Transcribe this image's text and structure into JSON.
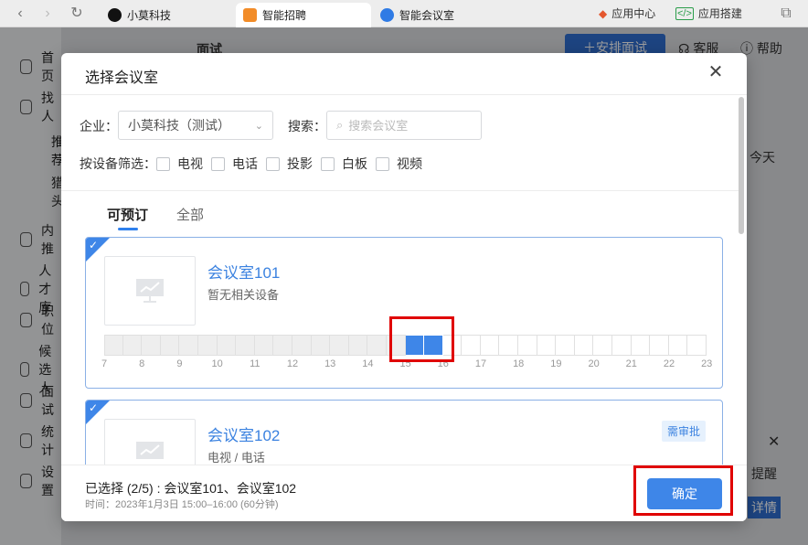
{
  "browser": {
    "tabs": [
      {
        "label": "小莫科技",
        "icon": "yin-yang-icon",
        "color": "#111111"
      },
      {
        "label": "智能招聘",
        "icon": "recruit-icon",
        "color": "#f28c28"
      },
      {
        "label": "智能会议室",
        "icon": "meeting-room-icon",
        "color": "#2f7be5"
      }
    ],
    "right_items": [
      {
        "label": "应用中心",
        "icon": "diamond-icon"
      },
      {
        "label": "应用搭建",
        "icon": "code-icon"
      }
    ]
  },
  "background": {
    "sidebar": [
      "首页",
      "找人",
      "推荐",
      "猎头",
      "内推",
      "人才库",
      "职位",
      "候选人",
      "面试",
      "统计",
      "设置"
    ],
    "page_title": "面试",
    "schedule_button": "安排面试",
    "service": "客服",
    "help": "帮助",
    "today": "今天",
    "remind": "提醒",
    "details": "详情"
  },
  "modal": {
    "title": "选择会议室",
    "company_label": "企业：",
    "company_value": "小莫科技（测试）",
    "search_label": "搜索：",
    "search_placeholder": "搜索会议室",
    "filter_label": "按设备筛选：",
    "filters": [
      "电视",
      "电话",
      "投影",
      "白板",
      "视频"
    ],
    "tabs": [
      "可预订",
      "全部"
    ],
    "rooms": [
      {
        "name": "会议室101",
        "equipment": "暂无相关设备",
        "selected": true,
        "needs_approval": false
      },
      {
        "name": "会议室102",
        "equipment": "电视 / 电话",
        "selected": true,
        "needs_approval": true,
        "approval_tag": "需审批"
      }
    ],
    "hours": [
      "7",
      "8",
      "9",
      "10",
      "11",
      "12",
      "13",
      "14",
      "15",
      "16",
      "17",
      "18",
      "19",
      "20",
      "21",
      "22",
      "23"
    ],
    "footer": {
      "selected_text": "已选择 (2/5) : 会议室101、会议室102",
      "time_text": "时间：2023年1月3日 15:00–16:00 (60分钟)",
      "confirm_label": "确定"
    }
  },
  "colors": {
    "accent": "#3e86e8",
    "highlight": "#e00000"
  }
}
